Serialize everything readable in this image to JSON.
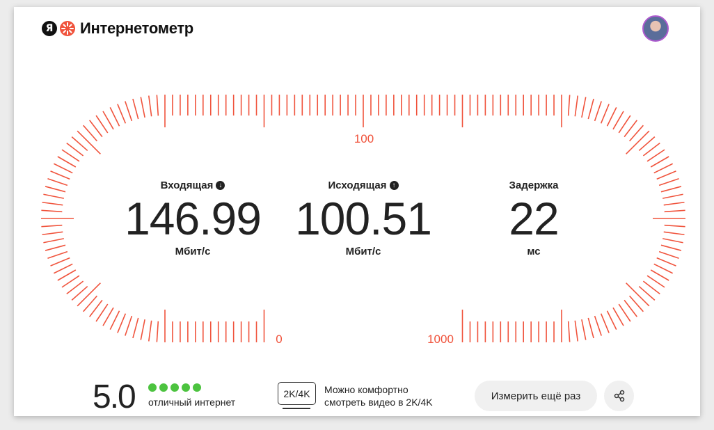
{
  "header": {
    "logo_letter": "Я",
    "title": "Интернетометр"
  },
  "gauge": {
    "labels": {
      "top": "100",
      "bottom_left": "0",
      "bottom_right": "1000"
    },
    "color": "#f0533c"
  },
  "metrics": [
    {
      "title": "Входящая",
      "icon": "arrow-down-icon",
      "value": "146.99",
      "unit": "Мбит/с"
    },
    {
      "title": "Исходящая",
      "icon": "arrow-up-icon",
      "value": "100.51",
      "unit": "Мбит/с"
    },
    {
      "title": "Задержка",
      "value": "22",
      "unit": "мс"
    }
  ],
  "rating": {
    "score": "5.0",
    "stars": 5,
    "max_stars": 5,
    "text": "отличный интернет",
    "color": "#4cc33f"
  },
  "quality": {
    "badge": "2K/4K",
    "line1": "Можно комфортно",
    "line2": "смотреть видео в 2K/4K"
  },
  "actions": {
    "retry": "Измерить ещё раз"
  }
}
